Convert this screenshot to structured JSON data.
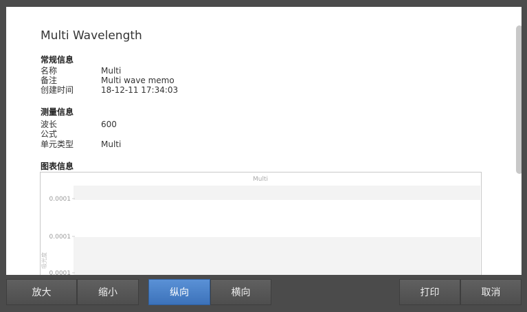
{
  "report": {
    "title": "Multi Wavelength",
    "general": {
      "heading": "常规信息",
      "rows": [
        {
          "label": "名称",
          "value": "Multi"
        },
        {
          "label": "备注",
          "value": "Multi wave memo"
        },
        {
          "label": "创建时间",
          "value": "18-12-11 17:34:03"
        }
      ]
    },
    "measurement": {
      "heading": "测量信息",
      "rows": [
        {
          "label": "波长",
          "value": "600"
        },
        {
          "label": "公式",
          "value": ""
        },
        {
          "label": "单元类型",
          "value": "Multi"
        }
      ]
    },
    "chart_section": {
      "heading": "图表信息"
    }
  },
  "chart_data": {
    "type": "line",
    "title": "Multi",
    "ylabel": "吸光度",
    "y_tick_labels": [
      "0.0001",
      "0.0001",
      "0.0001"
    ],
    "series": [],
    "grid": true,
    "band_color": "#f3f3f3"
  },
  "toolbar": {
    "zoom_in": "放大",
    "zoom_out": "缩小",
    "portrait": "纵向",
    "landscape": "横向",
    "print": "打印",
    "cancel": "取消",
    "active": "portrait"
  },
  "colors": {
    "accent": "#3f7ac4",
    "toolbar_bg": "#4b4b4b",
    "button_bg": "#575757"
  }
}
